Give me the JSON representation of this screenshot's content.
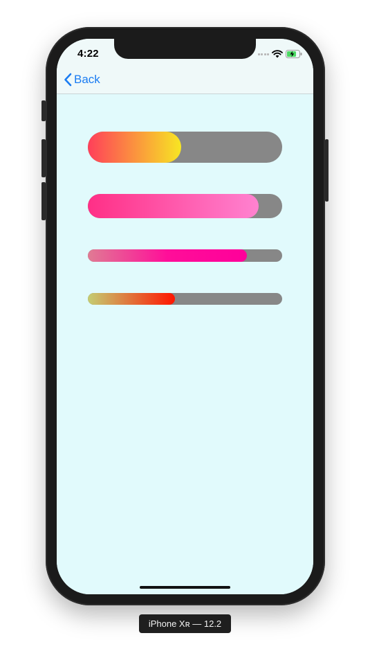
{
  "status_bar": {
    "time": "4:22",
    "icons": [
      "cellular-signal-icon",
      "wifi-icon",
      "battery-charging-icon"
    ],
    "battery_color": "#4cd964"
  },
  "nav": {
    "back_label": "Back",
    "tint_color": "#1a7cf2"
  },
  "progress_bars": [
    {
      "name": "progress-bar-1",
      "progress": 0.48,
      "track_color": "#878787",
      "gradient": [
        "#ff3f5a",
        "#f7e623"
      ]
    },
    {
      "name": "progress-bar-2",
      "progress": 0.88,
      "track_color": "#878787",
      "gradient": [
        "#ff2f86",
        "#ff82d0"
      ]
    },
    {
      "name": "progress-bar-3",
      "progress": 0.82,
      "track_color": "#878787",
      "gradient": [
        "#e07b94",
        "#ff0e99",
        "#ff009a"
      ]
    },
    {
      "name": "progress-bar-4",
      "progress": 0.45,
      "track_color": "#878787",
      "gradient": [
        "#c4cd72",
        "#ff1500"
      ]
    }
  ],
  "device_label": "iPhone Xʀ — 12.2"
}
